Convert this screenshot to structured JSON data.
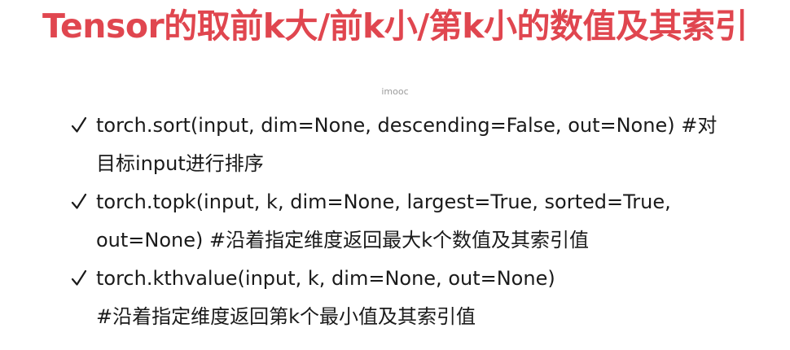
{
  "slide": {
    "title": "Tensor的取前k大/前k小/第k小的数值及其索引",
    "watermark": "imooc",
    "bullets": [
      {
        "icon": "check-icon",
        "lines": [
          "torch.sort(input, dim=None, descending=False, out=None) #对",
          "目标input进行排序"
        ]
      },
      {
        "icon": "check-icon",
        "lines": [
          "torch.topk(input, k, dim=None, largest=True, sorted=True,",
          "out=None)  #沿着指定维度返回最大k个数值及其索引值"
        ]
      },
      {
        "icon": "check-icon",
        "lines": [
          "torch.kthvalue(input, k, dim=None, out=None)",
          "#沿着指定维度返回第k个最小值及其索引值"
        ]
      }
    ]
  },
  "colors": {
    "title": "#e0464f",
    "text": "#1a1a1a",
    "watermark": "#9a9a9a"
  }
}
